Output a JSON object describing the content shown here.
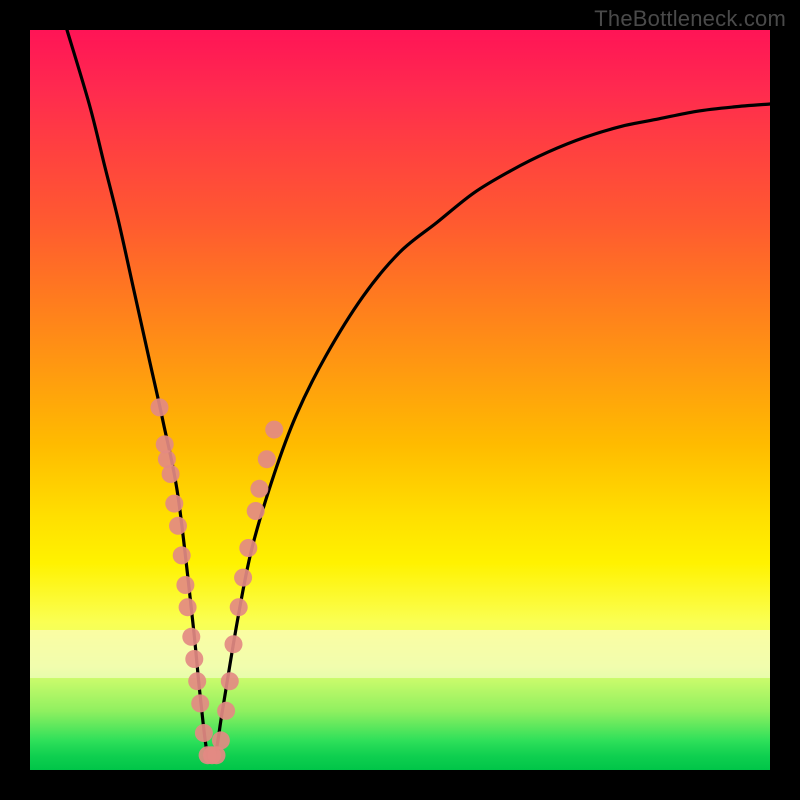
{
  "watermark": {
    "text": "TheBottleneck.com"
  },
  "gradient_colors": {
    "top": "#ff1456",
    "mid_orange": "#ff9a10",
    "mid_yellow": "#fff200",
    "bottom": "#00c548"
  },
  "chart_data": {
    "type": "line",
    "title": "",
    "xlabel": "",
    "ylabel": "",
    "xlim": [
      0,
      100
    ],
    "ylim": [
      0,
      100
    ],
    "note": "Black curve depicting bottleneck percentage; minimum near x≈24. y is percentage (0 = bottom/green = no bottleneck, 100 = top/red = full bottleneck). Values read off the plot.",
    "series": [
      {
        "name": "bottleneck-curve",
        "x": [
          5,
          8,
          10,
          12,
          14,
          16,
          18,
          20,
          22,
          23,
          24,
          25,
          26,
          28,
          30,
          33,
          36,
          40,
          45,
          50,
          55,
          60,
          65,
          70,
          75,
          80,
          85,
          90,
          95,
          100
        ],
        "y": [
          100,
          90,
          82,
          74,
          65,
          56,
          47,
          37,
          20,
          10,
          2,
          2,
          8,
          20,
          30,
          40,
          48,
          56,
          64,
          70,
          74,
          78,
          81,
          83.5,
          85.5,
          87,
          88,
          89,
          89.6,
          90
        ]
      }
    ],
    "scatter_overlay": {
      "name": "sample-points",
      "color": "#e38a83",
      "note": "Clustered salmon dots overlaid on the curve near the trough and lower flanks.",
      "points": [
        {
          "x": 17.5,
          "y": 49
        },
        {
          "x": 18.2,
          "y": 44
        },
        {
          "x": 18.5,
          "y": 42
        },
        {
          "x": 19.0,
          "y": 40
        },
        {
          "x": 19.5,
          "y": 36
        },
        {
          "x": 20.0,
          "y": 33
        },
        {
          "x": 20.5,
          "y": 29
        },
        {
          "x": 21.0,
          "y": 25
        },
        {
          "x": 21.3,
          "y": 22
        },
        {
          "x": 21.8,
          "y": 18
        },
        {
          "x": 22.2,
          "y": 15
        },
        {
          "x": 22.6,
          "y": 12
        },
        {
          "x": 23.0,
          "y": 9
        },
        {
          "x": 23.5,
          "y": 5
        },
        {
          "x": 24.0,
          "y": 2
        },
        {
          "x": 24.6,
          "y": 2
        },
        {
          "x": 25.2,
          "y": 2
        },
        {
          "x": 25.8,
          "y": 4
        },
        {
          "x": 26.5,
          "y": 8
        },
        {
          "x": 27.0,
          "y": 12
        },
        {
          "x": 27.5,
          "y": 17
        },
        {
          "x": 28.2,
          "y": 22
        },
        {
          "x": 28.8,
          "y": 26
        },
        {
          "x": 29.5,
          "y": 30
        },
        {
          "x": 30.5,
          "y": 35
        },
        {
          "x": 31.0,
          "y": 38
        },
        {
          "x": 32.0,
          "y": 42
        },
        {
          "x": 33.0,
          "y": 46
        }
      ]
    }
  }
}
